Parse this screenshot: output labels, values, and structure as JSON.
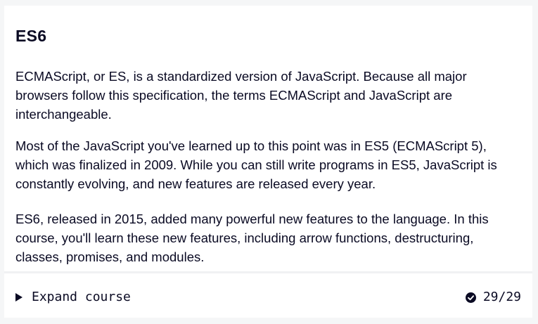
{
  "course": {
    "title": "ES6",
    "paragraphs": [
      "ECMAScript, or ES, is a standardized version of JavaScript. Because all major browsers follow this specification, the terms ECMAScript and JavaScript are interchangeable.",
      "Most of the JavaScript you've learned up to this point was in ES5 (ECMAScript 5), which was finalized in 2009. While you can still write programs in ES5, JavaScript is constantly evolving, and new features are released every year.",
      "ES6, released in 2015, added many powerful new features to the language. In this course, you'll learn these new features, including arrow functions, destructuring, classes, promises, and modules."
    ]
  },
  "footer": {
    "expand_label": "Expand course",
    "expand_icon": "triangle-right-icon",
    "progress_text": "29/29",
    "progress_icon": "check-circle-icon"
  },
  "colors": {
    "text": "#0a0a23",
    "background": "#f5f6f7",
    "card": "#ffffff"
  }
}
